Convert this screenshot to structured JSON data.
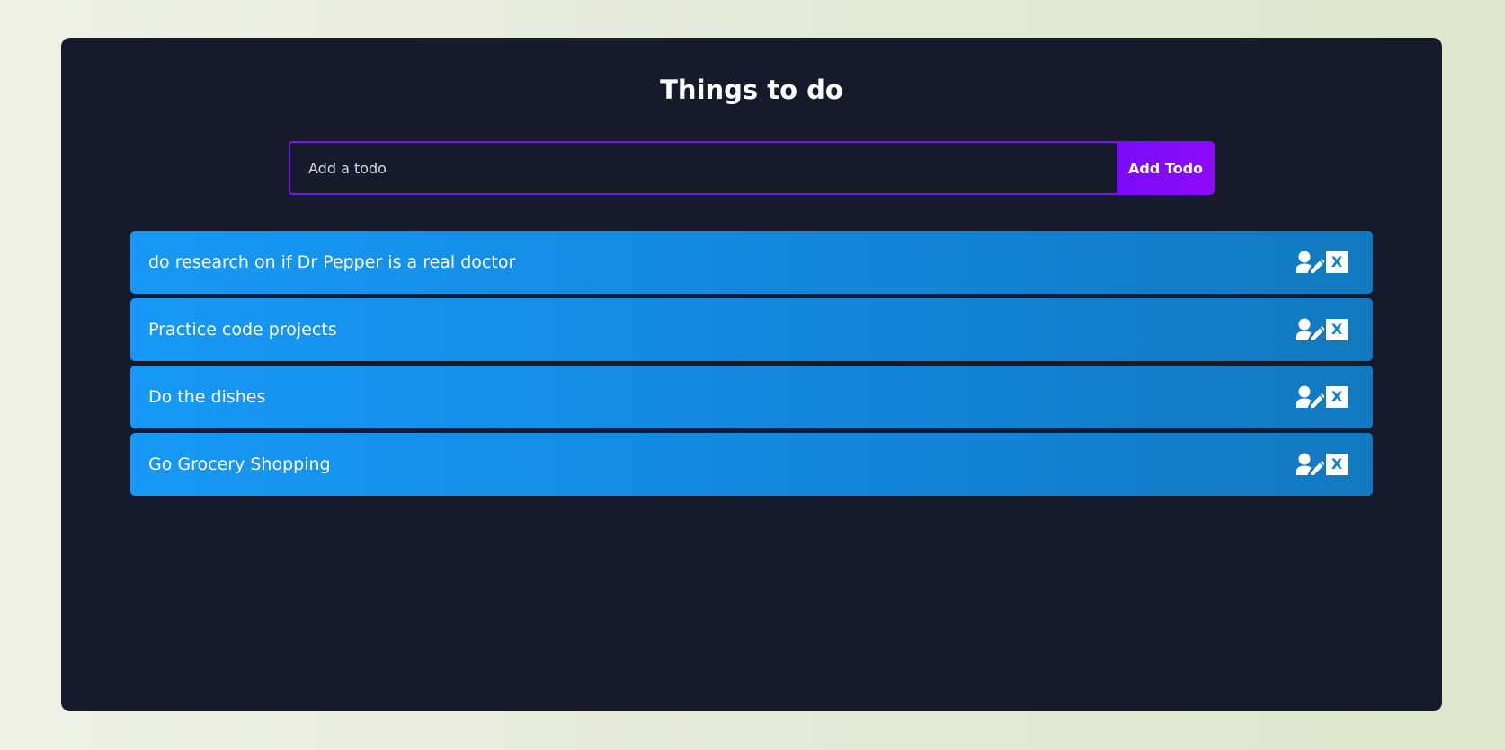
{
  "app": {
    "title": "Things to do"
  },
  "form": {
    "placeholder": "Add a todo",
    "value": "",
    "button_label": "Add Todo"
  },
  "todos": [
    {
      "text": "do research on if Dr Pepper is a real doctor",
      "edit_icon": "user-edit-icon",
      "delete_icon": "close-icon",
      "delete_glyph": "X"
    },
    {
      "text": "Practice code projects",
      "edit_icon": "user-edit-icon",
      "delete_icon": "close-icon",
      "delete_glyph": "X"
    },
    {
      "text": "Do the dishes",
      "edit_icon": "user-edit-icon",
      "delete_icon": "close-icon",
      "delete_glyph": "X"
    },
    {
      "text": "Go Grocery Shopping",
      "edit_icon": "user-edit-icon",
      "delete_icon": "close-icon",
      "delete_glyph": "X"
    }
  ],
  "colors": {
    "background": "#171a2b",
    "accent": "#8c0af9",
    "input_border": "#6f1aea",
    "todo_item": "#1699f6"
  }
}
